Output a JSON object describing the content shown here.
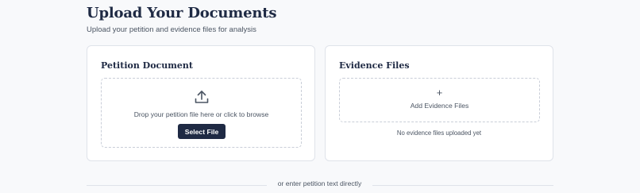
{
  "header": {
    "title": "Upload Your Documents",
    "subtitle": "Upload your petition and evidence files for analysis"
  },
  "petition": {
    "title": "Petition Document",
    "icon": "upload-icon",
    "drop_text": "Drop your petition file here or click to browse",
    "button_label": "Select File"
  },
  "evidence": {
    "title": "Evidence Files",
    "icon": "plus-icon",
    "plus_glyph": "+",
    "add_label": "Add Evidence Files",
    "empty_text": "No evidence files uploaded yet"
  },
  "divider": {
    "text": "or enter petition text directly"
  },
  "colors": {
    "primary": "#1f2a44",
    "muted_text": "#4b5563",
    "border": "#dfe3ea",
    "background": "#f8f9fb"
  }
}
